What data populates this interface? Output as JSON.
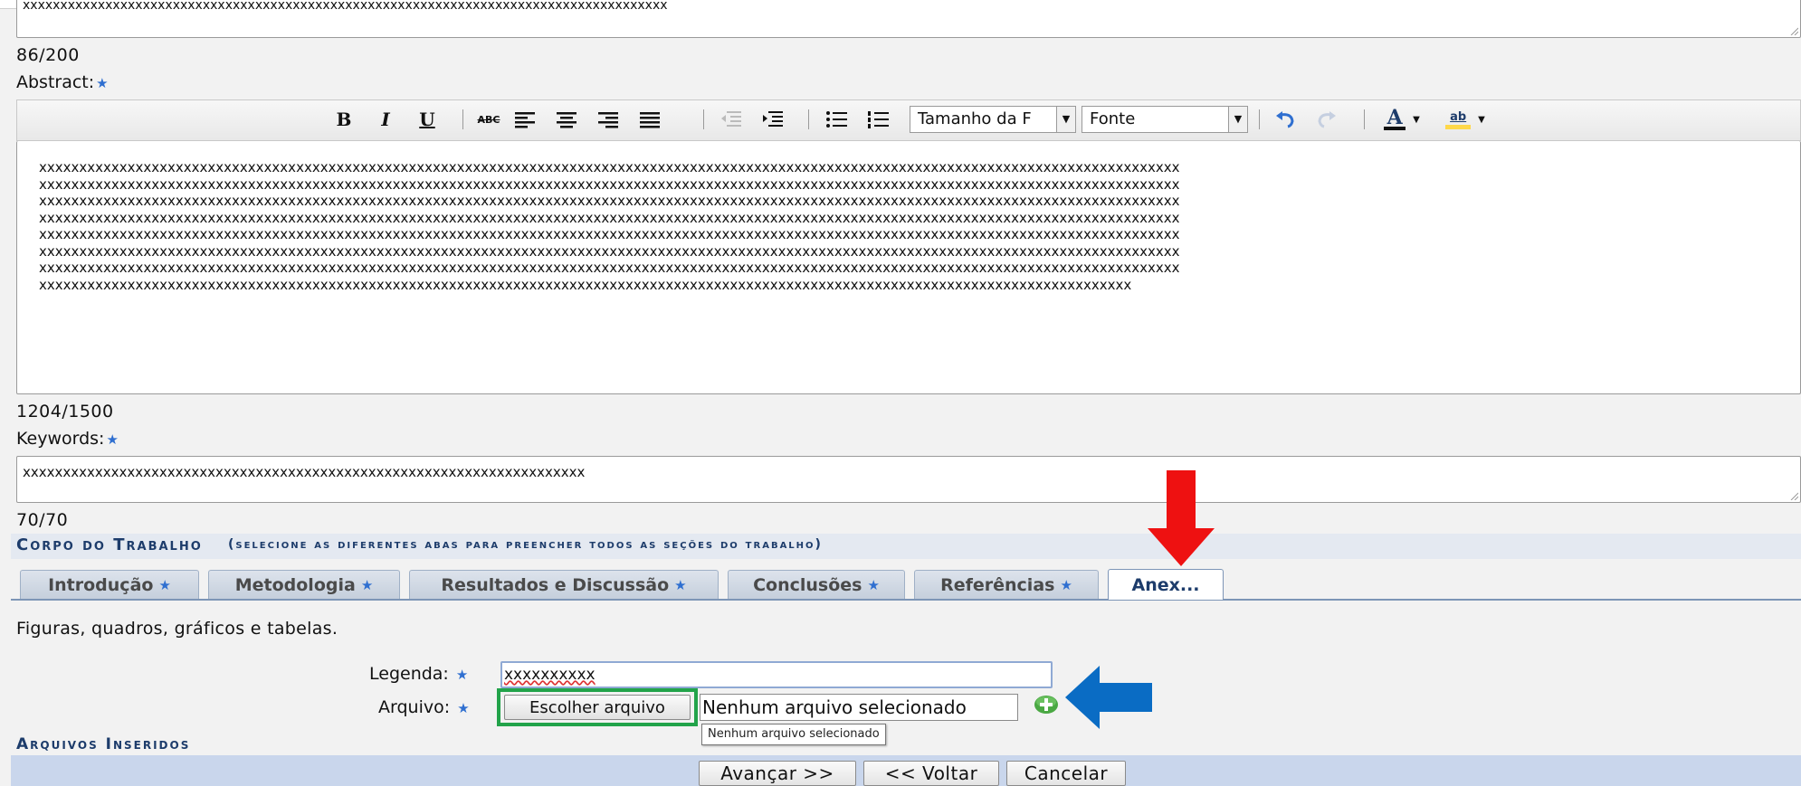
{
  "top_field": {
    "text": "xxxxxxxxxxxxxxxxxxxxxxxxxxxxxxxxxxxxxxxxxxxxxxxxxxxxxxxxxxxxxxxxxxxxxxxxxxxxxxxxxxxxxx",
    "counter": "86/200"
  },
  "abstract": {
    "label": "Abstract:",
    "toolbar": {
      "bold": "B",
      "italic": "I",
      "underline": "U",
      "strike": "ABC",
      "font_size": "Tamanho da F",
      "font": "Fonte",
      "text_color": "A",
      "highlight": "ab"
    },
    "lines": [
      "xxxxxxxxxxxxxxxxxxxxxxxxxxxxxxxxxxxxxxxxxxxxxxxxxxxxxxxxxxxxxxxxxxxxxxxxxxxxxxxxxxxxxxxxxxxxxxxxxxxxxxxxxxxxxxxxxxxxxxxxxxxxxxxxxxxxxxxxxxxxxx",
      "xxxxxxxxxxxxxxxxxxxxxxxxxxxxxxxxxxxxxxxxxxxxxxxxxxxxxxxxxxxxxxxxxxxxxxxxxxxxxxxxxxxxxxxxxxxxxxxxxxxxxxxxxxxxxxxxxxxxxxxxxxxxxxxxxxxxxxxxxxxxxx",
      "xxxxxxxxxxxxxxxxxxxxxxxxxxxxxxxxxxxxxxxxxxxxxxxxxxxxxxxxxxxxxxxxxxxxxxxxxxxxxxxxxxxxxxxxxxxxxxxxxxxxxxxxxxxxxxxxxxxxxxxxxxxxxxxxxxxxxxxxxxxxxx",
      "xxxxxxxxxxxxxxxxxxxxxxxxxxxxxxxxxxxxxxxxxxxxxxxxxxxxxxxxxxxxxxxxxxxxxxxxxxxxxxxxxxxxxxxxxxxxxxxxxxxxxxxxxxxxxxxxxxxxxxxxxxxxxxxxxxxxxxxxxxxxxx",
      "xxxxxxxxxxxxxxxxxxxxxxxxxxxxxxxxxxxxxxxxxxxxxxxxxxxxxxxxxxxxxxxxxxxxxxxxxxxxxxxxxxxxxxxxxxxxxxxxxxxxxxxxxxxxxxxxxxxxxxxxxxxxxxxxxxxxxxxxxxxxxx",
      "xxxxxxxxxxxxxxxxxxxxxxxxxxxxxxxxxxxxxxxxxxxxxxxxxxxxxxxxxxxxxxxxxxxxxxxxxxxxxxxxxxxxxxxxxxxxxxxxxxxxxxxxxxxxxxxxxxxxxxxxxxxxxxxxxxxxxxxxxxxxxx",
      "xxxxxxxxxxxxxxxxxxxxxxxxxxxxxxxxxxxxxxxxxxxxxxxxxxxxxxxxxxxxxxxxxxxxxxxxxxxxxxxxxxxxxxxxxxxxxxxxxxxxxxxxxxxxxxxxxxxxxxxxxxxxxxxxxxxxxxxxxxxxxx",
      "xxxxxxxxxxxxxxxxxxxxxxxxxxxxxxxxxxxxxxxxxxxxxxxxxxxxxxxxxxxxxxxxxxxxxxxxxxxxxxxxxxxxxxxxxxxxxxxxxxxxxxxxxxxxxxxxxxxxxxxxxxxxxxxxxxxxxxxx"
    ],
    "counter": "1204/1500"
  },
  "keywords": {
    "label": "Keywords:",
    "text": "xxxxxxxxxxxxxxxxxxxxxxxxxxxxxxxxxxxxxxxxxxxxxxxxxxxxxxxxxxxxxxxxxxxxxx",
    "counter": "70/70"
  },
  "body_section": {
    "title": "Corpo do Trabalho",
    "subtitle": "(selecione as diferentes abas para preencher todos as seções do trabalho)"
  },
  "tabs": [
    {
      "label": "Introdução"
    },
    {
      "label": "Metodologia"
    },
    {
      "label": "Resultados e Discussão"
    },
    {
      "label": "Conclusões"
    },
    {
      "label": "Referências"
    },
    {
      "label": "Anex..."
    }
  ],
  "annex": {
    "description": "Figuras, quadros, gráficos e tabelas.",
    "caption_label": "Legenda:",
    "caption_value": "xxxxxxxxxx",
    "file_label": "Arquivo:",
    "choose_file": "Escolher arquivo",
    "no_file": "Nenhum arquivo selecionado",
    "tooltip": "Nenhum arquivo selecionado"
  },
  "inserted_files": {
    "title": "Arquivos Inseridos"
  },
  "footer": {
    "next": "Avançar >>",
    "back": "<< Voltar",
    "cancel": "Cancelar"
  },
  "colors": {
    "accent_blue": "#1d3c6b",
    "star": "#2f6fd0",
    "arrow_red": "#ee1111",
    "arrow_blue": "#0a6cc4",
    "highlight_green": "#22a34a"
  },
  "icons": {
    "required": "star-icon",
    "add": "add-circle-icon"
  }
}
